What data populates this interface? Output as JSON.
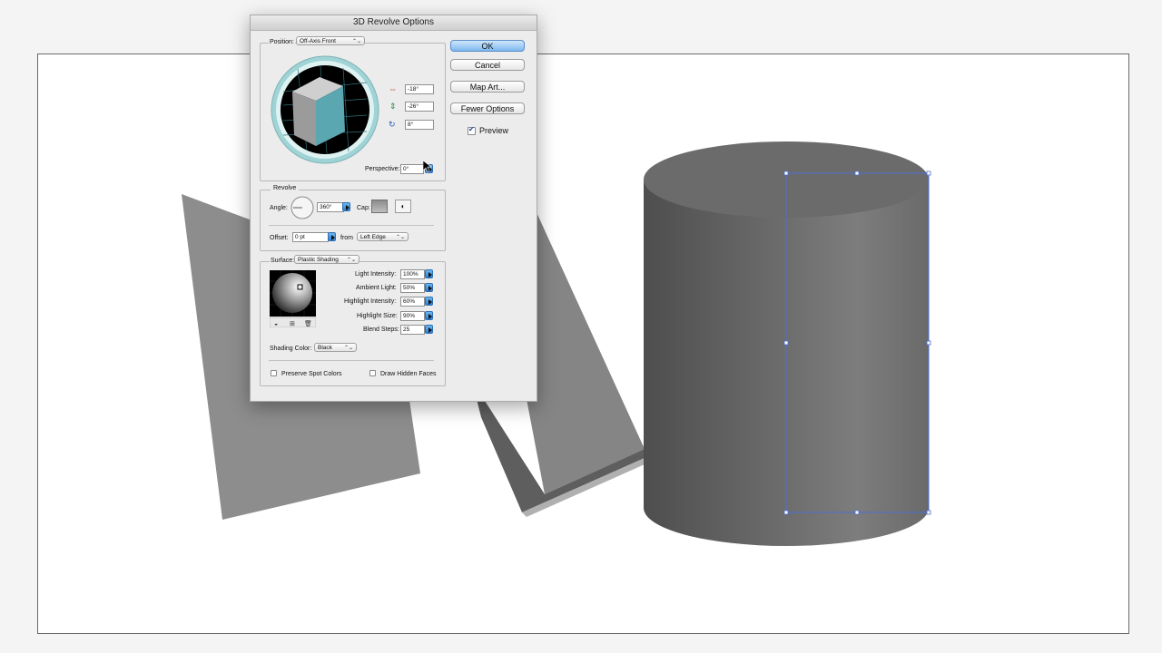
{
  "dialog": {
    "title": "3D Revolve Options",
    "position": {
      "label": "Position:",
      "selected": "Off-Axis Front"
    },
    "rotation": {
      "x": "-18°",
      "y": "-26°",
      "z": "8°"
    },
    "perspective": {
      "label": "Perspective:",
      "value": "0°"
    },
    "revolve": {
      "legend": "Revolve",
      "angle_label": "Angle:",
      "angle_value": "360°",
      "cap_label": "Cap:",
      "offset_label": "Offset:",
      "offset_value": "0 pt",
      "from_label": "from",
      "from_selected": "Left Edge"
    },
    "surface": {
      "label": "Surface:",
      "selected": "Plastic Shading",
      "light_intensity_label": "Light Intensity:",
      "light_intensity": "100%",
      "ambient_light_label": "Ambient Light:",
      "ambient_light": "50%",
      "highlight_intensity_label": "Highlight Intensity:",
      "highlight_intensity": "60%",
      "highlight_size_label": "Highlight Size:",
      "highlight_size": "90%",
      "blend_steps_label": "Blend Steps:",
      "blend_steps": "25",
      "shading_color_label": "Shading Color:",
      "shading_color": "Black",
      "preserve_spot_label": "Preserve Spot Colors",
      "draw_hidden_label": "Draw Hidden Faces"
    },
    "buttons": {
      "ok": "OK",
      "cancel": "Cancel",
      "map_art": "Map Art...",
      "fewer_options": "Fewer Options"
    },
    "preview": {
      "label": "Preview",
      "checked": true
    }
  },
  "colors": {
    "cube_front": "#5aa7b1",
    "cube_top": "#c9c9c9",
    "cube_side": "#9a9a9a",
    "selection": "#4c6fd6",
    "object_gray": "#7a7a7a"
  },
  "icons": [
    "x-rotation-icon",
    "y-rotation-icon",
    "z-rotation-icon",
    "cap-on-icon",
    "cap-off-icon",
    "new-light-icon",
    "move-light-back-icon",
    "delete-light-icon"
  ]
}
